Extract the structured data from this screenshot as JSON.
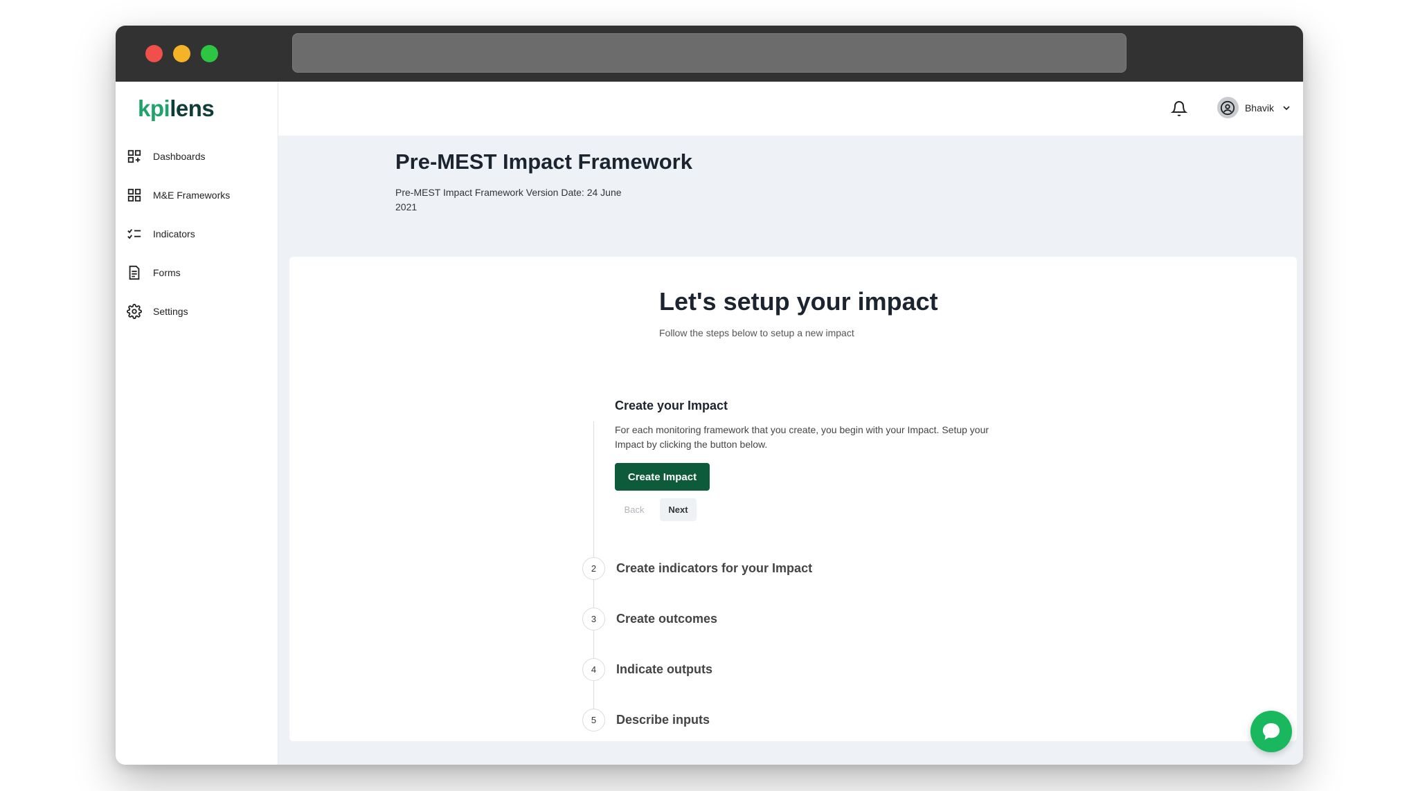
{
  "brand": {
    "logo_part1": "kpi",
    "logo_part2": "lens"
  },
  "colors": {
    "brand_green": "#1fa36b",
    "primary_button": "#0d5b3a",
    "chat_button": "#19b75e",
    "content_bg": "#eef2f6"
  },
  "sidebar": {
    "items": [
      {
        "label": "Dashboards",
        "icon": "dashboard-icon"
      },
      {
        "label": "M&E Frameworks",
        "icon": "grid-icon"
      },
      {
        "label": "Indicators",
        "icon": "checklist-icon"
      },
      {
        "label": "Forms",
        "icon": "form-icon"
      },
      {
        "label": "Settings",
        "icon": "gear-icon"
      }
    ]
  },
  "topbar": {
    "user_name": "Bhavik",
    "bell_icon": "bell-icon",
    "avatar_icon": "user-circle-icon"
  },
  "header": {
    "title": "Pre-MEST Impact Framework",
    "subtitle": "Pre-MEST Impact Framework Version Date: 24 June 2021"
  },
  "setup": {
    "title": "Let's setup your impact",
    "subtitle": "Follow the steps below to setup a new impact",
    "active_step": {
      "title": "Create your Impact",
      "description": "For each monitoring framework that you create, you begin with your Impact. Setup your Impact by clicking the button below.",
      "create_button": "Create Impact",
      "back_button": "Back",
      "next_button": "Next"
    },
    "steps": [
      {
        "number": "2",
        "label": "Create indicators for your Impact"
      },
      {
        "number": "3",
        "label": "Create outcomes"
      },
      {
        "number": "4",
        "label": "Indicate outputs"
      },
      {
        "number": "5",
        "label": "Describe inputs"
      }
    ]
  }
}
